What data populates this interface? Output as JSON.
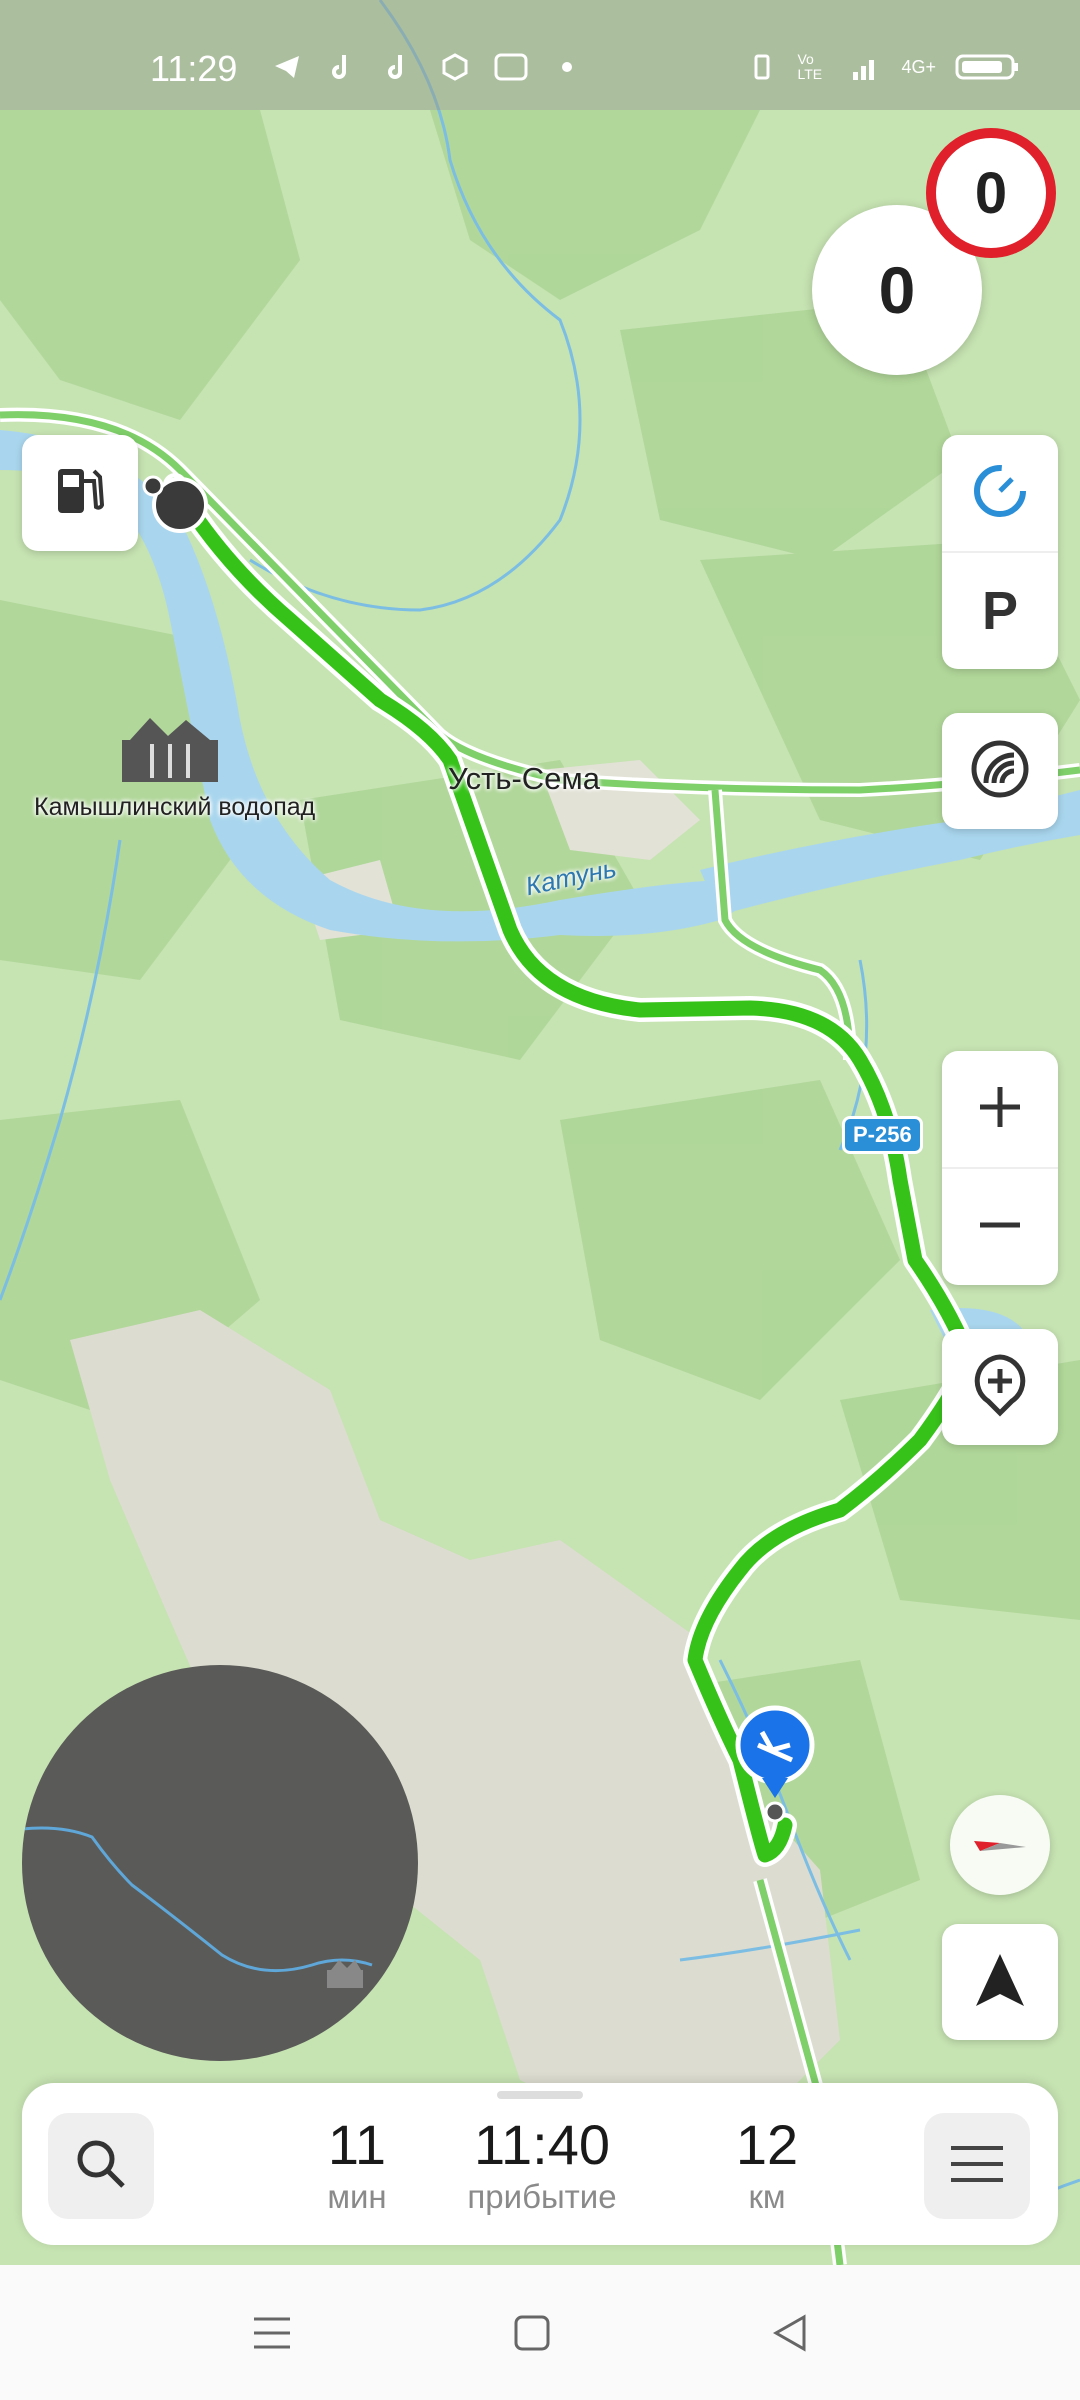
{
  "status_bar": {
    "time": "11:29",
    "network": "4G+",
    "volte": "Vo LTE"
  },
  "speed": {
    "current": "0",
    "limit": "0"
  },
  "map": {
    "place_label": "Усть-Сема",
    "river_label": "Катунь",
    "poi_label": "Камышлинский водопад",
    "road_shield": "Р-256"
  },
  "trip": {
    "duration_value": "11",
    "duration_unit": "мин",
    "arrival_value": "11:40",
    "arrival_unit": "прибытие",
    "distance_value": "12",
    "distance_unit": "км"
  },
  "colors": {
    "route": "#37c21a",
    "water": "#a9d6ee",
    "forest": "#b9dca3",
    "accent_blue": "#2b8fd8",
    "speed_limit_red": "#e0202a"
  },
  "icons": [
    "fuel-icon",
    "parking-icon",
    "traffic-icon",
    "zoom-in-icon",
    "zoom-out-icon",
    "add-road-event-icon",
    "compass-icon",
    "navigation-arrow-icon",
    "search-icon",
    "menu-icon"
  ]
}
